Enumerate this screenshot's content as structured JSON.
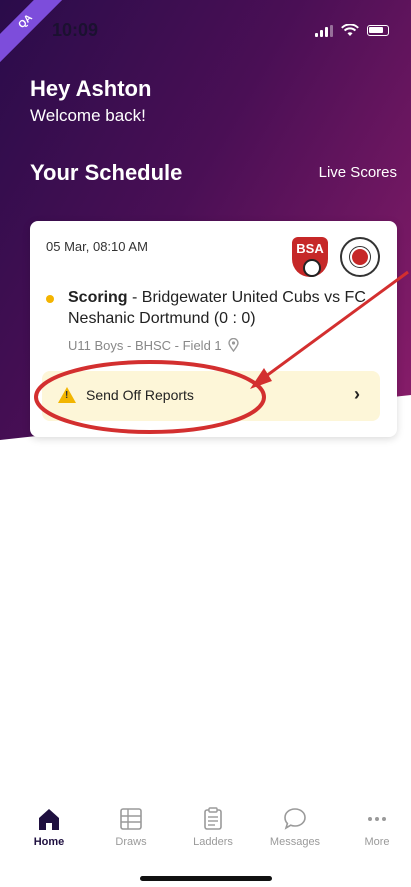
{
  "env_badge": "QA",
  "status_bar": {
    "time": "10:09"
  },
  "header": {
    "greeting": "Hey Ashton",
    "welcome": "Welcome back!"
  },
  "schedule": {
    "title": "Your Schedule",
    "live_scores_label": "Live Scores"
  },
  "match_card": {
    "datetime": "05 Mar, 08:10 AM",
    "home_badge_text": "BSA",
    "status_label": "Scoring",
    "teams_text": " - Bridgewater United Cubs vs FC Neshanic Dortmund (0 : 0)",
    "meta": "U11 Boys - BHSC - Field 1",
    "report_label": "Send Off Reports",
    "status_color": "#f4b400"
  },
  "tabs": [
    {
      "label": "Home",
      "icon": "home-icon",
      "active": true
    },
    {
      "label": "Draws",
      "icon": "draws-icon",
      "active": false
    },
    {
      "label": "Ladders",
      "icon": "ladders-icon",
      "active": false
    },
    {
      "label": "Messages",
      "icon": "messages-icon",
      "active": false
    },
    {
      "label": "More",
      "icon": "more-icon",
      "active": false
    }
  ],
  "colors": {
    "brand_gradient_start": "#2a0c4a",
    "brand_gradient_end": "#8a1d6a",
    "annotation_red": "#d32f2f",
    "report_background": "#fdf6d8"
  }
}
